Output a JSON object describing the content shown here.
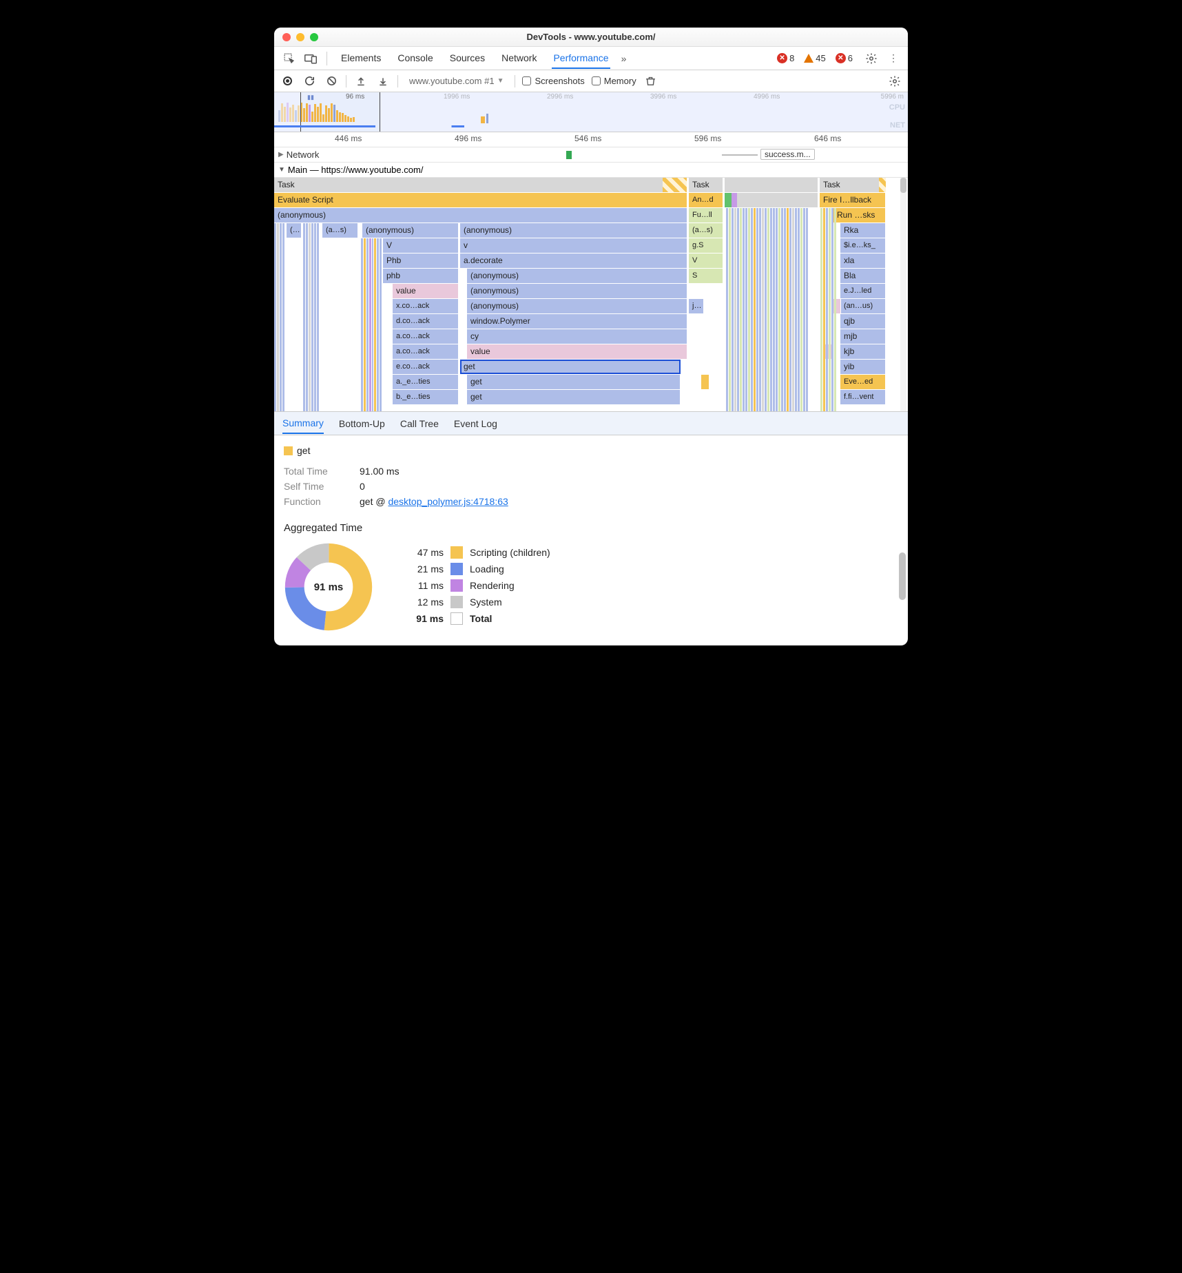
{
  "window": {
    "title": "DevTools - www.youtube.com/"
  },
  "devtoolsTabs": [
    "Elements",
    "Console",
    "Sources",
    "Network",
    "Performance"
  ],
  "devtoolsActive": "Performance",
  "statusBar": {
    "errors": 8,
    "warnings": 45,
    "xerrors": 6
  },
  "perfToolbar": {
    "target": "www.youtube.com #1",
    "screenshots_label": "Screenshots",
    "memory_label": "Memory"
  },
  "overviewTicks": [
    "96 ms",
    "1996 ms",
    "2996 ms",
    "3996 ms",
    "4996 ms",
    "5996 m"
  ],
  "overviewLabels": {
    "cpu": "CPU",
    "net": "NET"
  },
  "rulerTicks": [
    "446 ms",
    "496 ms",
    "546 ms",
    "596 ms",
    "646 ms"
  ],
  "network": {
    "label": "Network",
    "item": "success.m..."
  },
  "mainThread": {
    "label": "Main — https://www.youtube.com/"
  },
  "flame": {
    "col1": {
      "task": "Task",
      "eval": "Evaluate Script",
      "anon": "(anonymous)",
      "r3": [
        "(…",
        "(a…s)",
        "(anonymous)",
        "(anonymous)"
      ],
      "r4": [
        "V",
        "v"
      ],
      "r5": [
        "Phb",
        "a.decorate"
      ],
      "r6": [
        "phb",
        "(anonymous)"
      ],
      "r7": [
        "value",
        "(anonymous)"
      ],
      "r8": [
        "x.co…ack",
        "(anonymous)"
      ],
      "r9": [
        "d.co…ack",
        "window.Polymer"
      ],
      "r10": [
        "a.co…ack",
        "cy"
      ],
      "r11": [
        "a.co…ack",
        "value"
      ],
      "r12": [
        "e.co…ack",
        "get"
      ],
      "r13": [
        "a._e…ties",
        "get"
      ],
      "r14": [
        "b._e…ties",
        "get"
      ]
    },
    "col2": {
      "task": "Task",
      "l1": "An…d",
      "l2": "Fu…ll",
      "l3": "(a…s)",
      "l4": "g.S",
      "l5": "V",
      "l6": "S",
      "l8": "j…"
    },
    "col3": {
      "task": "Task",
      "l1": "Fire I…llback",
      "l2": "Run …sks",
      "r": [
        "Rka",
        "$i.e…ks_",
        "xla",
        "Bla",
        "e.J…led",
        "(an…us)",
        "qjb",
        "mjb",
        "kjb",
        "yib",
        "Eve…ed",
        "f.fi…vent"
      ]
    }
  },
  "bottomTabs": [
    "Summary",
    "Bottom-Up",
    "Call Tree",
    "Event Log"
  ],
  "bottomActive": "Summary",
  "summary": {
    "name": "get",
    "totalTime_label": "Total Time",
    "totalTime": "91.00 ms",
    "selfTime_label": "Self Time",
    "selfTime": "0",
    "function_label": "Function",
    "functionPrefix": "get @ ",
    "functionLink": "desktop_polymer.js:4718:63",
    "agg_title": "Aggregated Time",
    "donut_center": "91 ms",
    "legend": [
      {
        "t": "47 ms",
        "c": "sw-y",
        "l": "Scripting (children)"
      },
      {
        "t": "21 ms",
        "c": "sw-b",
        "l": "Loading"
      },
      {
        "t": "11 ms",
        "c": "sw-p",
        "l": "Rendering"
      },
      {
        "t": "12 ms",
        "c": "sw-g",
        "l": "System"
      },
      {
        "t": "91 ms",
        "c": "sw-w",
        "l": "Total",
        "total": true
      }
    ]
  },
  "chart_data": {
    "type": "pie",
    "title": "Aggregated Time",
    "series": [
      {
        "name": "get",
        "values": [
          47,
          21,
          11,
          12
        ]
      }
    ],
    "categories": [
      "Scripting (children)",
      "Loading",
      "Rendering",
      "System"
    ],
    "total": 91,
    "unit": "ms"
  }
}
